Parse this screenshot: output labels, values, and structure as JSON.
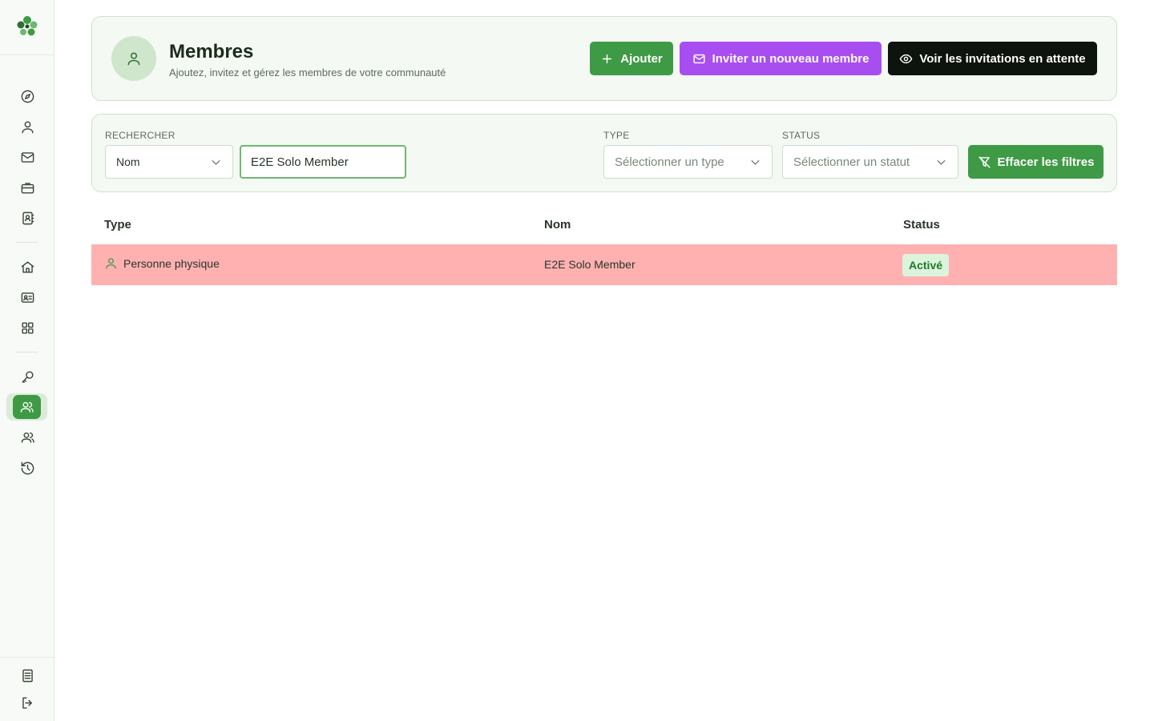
{
  "header": {
    "title": "Membres",
    "subtitle": "Ajoutez, invitez et gérez les membres de votre communauté",
    "add_label": "Ajouter",
    "invite_label": "Inviter un nouveau membre",
    "pending_label": "Voir les invitations en attente"
  },
  "filters": {
    "search_label": "RECHERCHER",
    "search_field": "Nom",
    "search_value": "E2E Solo Member",
    "type_label": "TYPE",
    "type_placeholder": "Sélectionner un type",
    "status_label": "STATUS",
    "status_placeholder": "Sélectionner un statut",
    "clear_label": "Effacer les filtres"
  },
  "table": {
    "columns": [
      "Type",
      "Nom",
      "Status"
    ],
    "rows": [
      {
        "type": "Personne physique",
        "name": "E2E Solo Member",
        "status": "Activé"
      }
    ]
  },
  "colors": {
    "primary_green": "#3e9a45",
    "invite_purple": "#a84ef0",
    "dark_button": "#0d130d",
    "highlight_row": "#ffb1b1",
    "badge_bg": "#dcf3dc"
  },
  "sidebar": {
    "icons": [
      "compass-icon",
      "user-icon",
      "mail-icon",
      "briefcase-icon",
      "contact-book-icon",
      "home-icon",
      "id-card-icon",
      "grid-icon",
      "key-icon",
      "members-icon",
      "users-icon",
      "history-icon",
      "document-icon",
      "logout-icon"
    ]
  }
}
